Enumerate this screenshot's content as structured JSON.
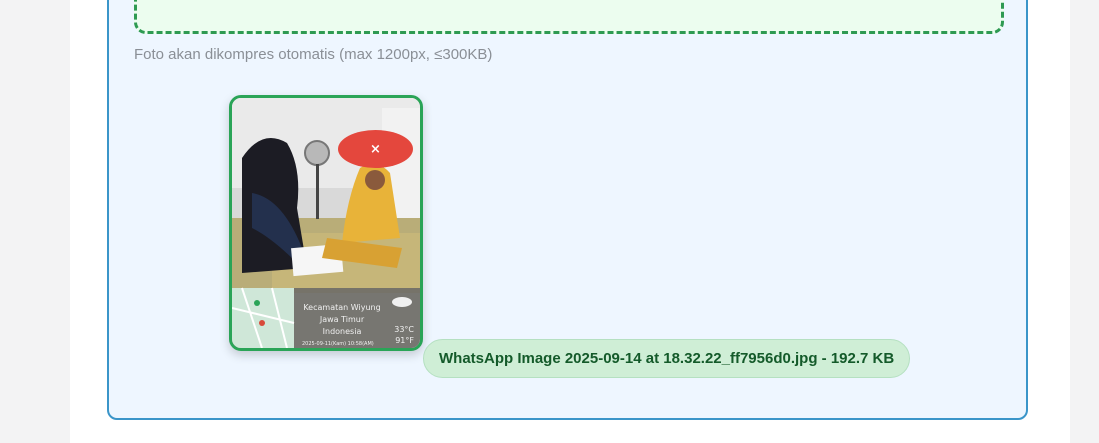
{
  "upload": {
    "hint": "Foto akan dikompres otomatis (max 1200px, ≤300KB)",
    "remove_icon": "×",
    "file_info": "WhatsApp Image 2025-09-14 at 18.32.22_ff7956d0.jpg - 192.7 KB"
  },
  "photo_overlay": {
    "district": "Kecamatan Wiyung",
    "province": "Jawa Timur",
    "country": "Indonesia",
    "temp_c": "33°C",
    "temp_f": "91°F",
    "timestamp": "2025-09-11(Kam)  10:58(AM)"
  },
  "colors": {
    "accent_border": "#3a95c9",
    "success": "#2aa457",
    "danger": "#e4473d"
  }
}
